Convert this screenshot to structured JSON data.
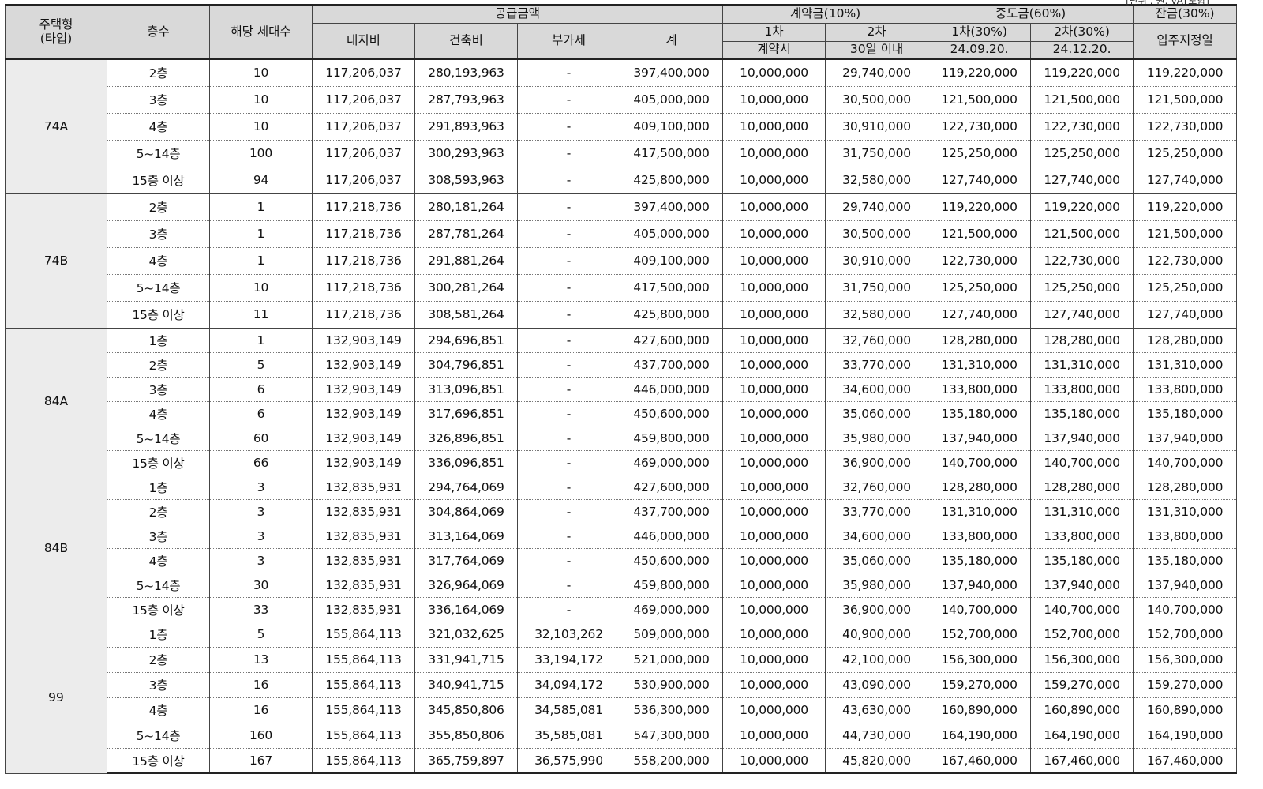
{
  "unit_note": "[단위 : 원, VAT포함]",
  "headers": {
    "type": "주택형\n(타입)",
    "floor": "층수",
    "units": "해당 세대수",
    "supply": "공급금액",
    "land": "대지비",
    "building": "건축비",
    "vat": "부가세",
    "total": "계",
    "deposit": "계약금(10%)",
    "dep1": "1차",
    "dep1_when": "계약시",
    "dep2": "2차",
    "dep2_when": "30일 이내",
    "mid": "중도금(60%)",
    "mid1": "1차(30%)",
    "mid1_when": "24.09.20.",
    "mid2": "2차(30%)",
    "mid2_when": "24.12.20.",
    "balance": "잔금(30%)",
    "balance_when": "입주지정일"
  },
  "groups": [
    {
      "type": "74A",
      "rows": [
        [
          "2층",
          "10",
          "117,206,037",
          "280,193,963",
          "-",
          "397,400,000",
          "10,000,000",
          "29,740,000",
          "119,220,000",
          "119,220,000",
          "119,220,000"
        ],
        [
          "3층",
          "10",
          "117,206,037",
          "287,793,963",
          "-",
          "405,000,000",
          "10,000,000",
          "30,500,000",
          "121,500,000",
          "121,500,000",
          "121,500,000"
        ],
        [
          "4층",
          "10",
          "117,206,037",
          "291,893,963",
          "-",
          "409,100,000",
          "10,000,000",
          "30,910,000",
          "122,730,000",
          "122,730,000",
          "122,730,000"
        ],
        [
          "5~14층",
          "100",
          "117,206,037",
          "300,293,963",
          "-",
          "417,500,000",
          "10,000,000",
          "31,750,000",
          "125,250,000",
          "125,250,000",
          "125,250,000"
        ],
        [
          "15층 이상",
          "94",
          "117,206,037",
          "308,593,963",
          "-",
          "425,800,000",
          "10,000,000",
          "32,580,000",
          "127,740,000",
          "127,740,000",
          "127,740,000"
        ]
      ]
    },
    {
      "type": "74B",
      "rows": [
        [
          "2층",
          "1",
          "117,218,736",
          "280,181,264",
          "-",
          "397,400,000",
          "10,000,000",
          "29,740,000",
          "119,220,000",
          "119,220,000",
          "119,220,000"
        ],
        [
          "3층",
          "1",
          "117,218,736",
          "287,781,264",
          "-",
          "405,000,000",
          "10,000,000",
          "30,500,000",
          "121,500,000",
          "121,500,000",
          "121,500,000"
        ],
        [
          "4층",
          "1",
          "117,218,736",
          "291,881,264",
          "-",
          "409,100,000",
          "10,000,000",
          "30,910,000",
          "122,730,000",
          "122,730,000",
          "122,730,000"
        ],
        [
          "5~14층",
          "10",
          "117,218,736",
          "300,281,264",
          "-",
          "417,500,000",
          "10,000,000",
          "31,750,000",
          "125,250,000",
          "125,250,000",
          "125,250,000"
        ],
        [
          "15층 이상",
          "11",
          "117,218,736",
          "308,581,264",
          "-",
          "425,800,000",
          "10,000,000",
          "32,580,000",
          "127,740,000",
          "127,740,000",
          "127,740,000"
        ]
      ]
    },
    {
      "type": "84A",
      "rows": [
        [
          "1층",
          "1",
          "132,903,149",
          "294,696,851",
          "-",
          "427,600,000",
          "10,000,000",
          "32,760,000",
          "128,280,000",
          "128,280,000",
          "128,280,000"
        ],
        [
          "2층",
          "5",
          "132,903,149",
          "304,796,851",
          "-",
          "437,700,000",
          "10,000,000",
          "33,770,000",
          "131,310,000",
          "131,310,000",
          "131,310,000"
        ],
        [
          "3층",
          "6",
          "132,903,149",
          "313,096,851",
          "-",
          "446,000,000",
          "10,000,000",
          "34,600,000",
          "133,800,000",
          "133,800,000",
          "133,800,000"
        ],
        [
          "4층",
          "6",
          "132,903,149",
          "317,696,851",
          "-",
          "450,600,000",
          "10,000,000",
          "35,060,000",
          "135,180,000",
          "135,180,000",
          "135,180,000"
        ],
        [
          "5~14층",
          "60",
          "132,903,149",
          "326,896,851",
          "-",
          "459,800,000",
          "10,000,000",
          "35,980,000",
          "137,940,000",
          "137,940,000",
          "137,940,000"
        ],
        [
          "15층 이상",
          "66",
          "132,903,149",
          "336,096,851",
          "-",
          "469,000,000",
          "10,000,000",
          "36,900,000",
          "140,700,000",
          "140,700,000",
          "140,700,000"
        ]
      ]
    },
    {
      "type": "84B",
      "rows": [
        [
          "1층",
          "3",
          "132,835,931",
          "294,764,069",
          "-",
          "427,600,000",
          "10,000,000",
          "32,760,000",
          "128,280,000",
          "128,280,000",
          "128,280,000"
        ],
        [
          "2층",
          "3",
          "132,835,931",
          "304,864,069",
          "-",
          "437,700,000",
          "10,000,000",
          "33,770,000",
          "131,310,000",
          "131,310,000",
          "131,310,000"
        ],
        [
          "3층",
          "3",
          "132,835,931",
          "313,164,069",
          "-",
          "446,000,000",
          "10,000,000",
          "34,600,000",
          "133,800,000",
          "133,800,000",
          "133,800,000"
        ],
        [
          "4층",
          "3",
          "132,835,931",
          "317,764,069",
          "-",
          "450,600,000",
          "10,000,000",
          "35,060,000",
          "135,180,000",
          "135,180,000",
          "135,180,000"
        ],
        [
          "5~14층",
          "30",
          "132,835,931",
          "326,964,069",
          "-",
          "459,800,000",
          "10,000,000",
          "35,980,000",
          "137,940,000",
          "137,940,000",
          "137,940,000"
        ],
        [
          "15층 이상",
          "33",
          "132,835,931",
          "336,164,069",
          "-",
          "469,000,000",
          "10,000,000",
          "36,900,000",
          "140,700,000",
          "140,700,000",
          "140,700,000"
        ]
      ]
    },
    {
      "type": "99",
      "rows": [
        [
          "1층",
          "5",
          "155,864,113",
          "321,032,625",
          "32,103,262",
          "509,000,000",
          "10,000,000",
          "40,900,000",
          "152,700,000",
          "152,700,000",
          "152,700,000"
        ],
        [
          "2층",
          "13",
          "155,864,113",
          "331,941,715",
          "33,194,172",
          "521,000,000",
          "10,000,000",
          "42,100,000",
          "156,300,000",
          "156,300,000",
          "156,300,000"
        ],
        [
          "3층",
          "16",
          "155,864,113",
          "340,941,715",
          "34,094,172",
          "530,900,000",
          "10,000,000",
          "43,090,000",
          "159,270,000",
          "159,270,000",
          "159,270,000"
        ],
        [
          "4층",
          "16",
          "155,864,113",
          "345,850,806",
          "34,585,081",
          "536,300,000",
          "10,000,000",
          "43,630,000",
          "160,890,000",
          "160,890,000",
          "160,890,000"
        ],
        [
          "5~14층",
          "160",
          "155,864,113",
          "355,850,806",
          "35,585,081",
          "547,300,000",
          "10,000,000",
          "44,730,000",
          "164,190,000",
          "164,190,000",
          "164,190,000"
        ],
        [
          "15층 이상",
          "167",
          "155,864,113",
          "365,759,897",
          "36,575,990",
          "558,200,000",
          "10,000,000",
          "45,820,000",
          "167,460,000",
          "167,460,000",
          "167,460,000"
        ]
      ]
    }
  ]
}
